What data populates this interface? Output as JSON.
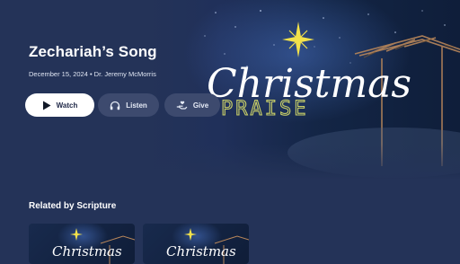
{
  "episode": {
    "title": "Zechariah’s Song",
    "meta": "December 15, 2024 • Dr. Jeremy McMorris"
  },
  "actions": {
    "watch_label": "Watch",
    "listen_label": "Listen",
    "give_label": "Give"
  },
  "artwork": {
    "line1": "Christmas",
    "line2": "PRAISE"
  },
  "related": {
    "heading": "Related by Scripture",
    "items": [
      {
        "title_art": "Christmas"
      },
      {
        "title_art": "Christmas"
      }
    ]
  },
  "colors": {
    "background": "#243358",
    "button_primary": "#ffffff",
    "button_secondary": "#3d4a6e",
    "star": "#f3e24a",
    "praise_text": "#c9cf68"
  }
}
